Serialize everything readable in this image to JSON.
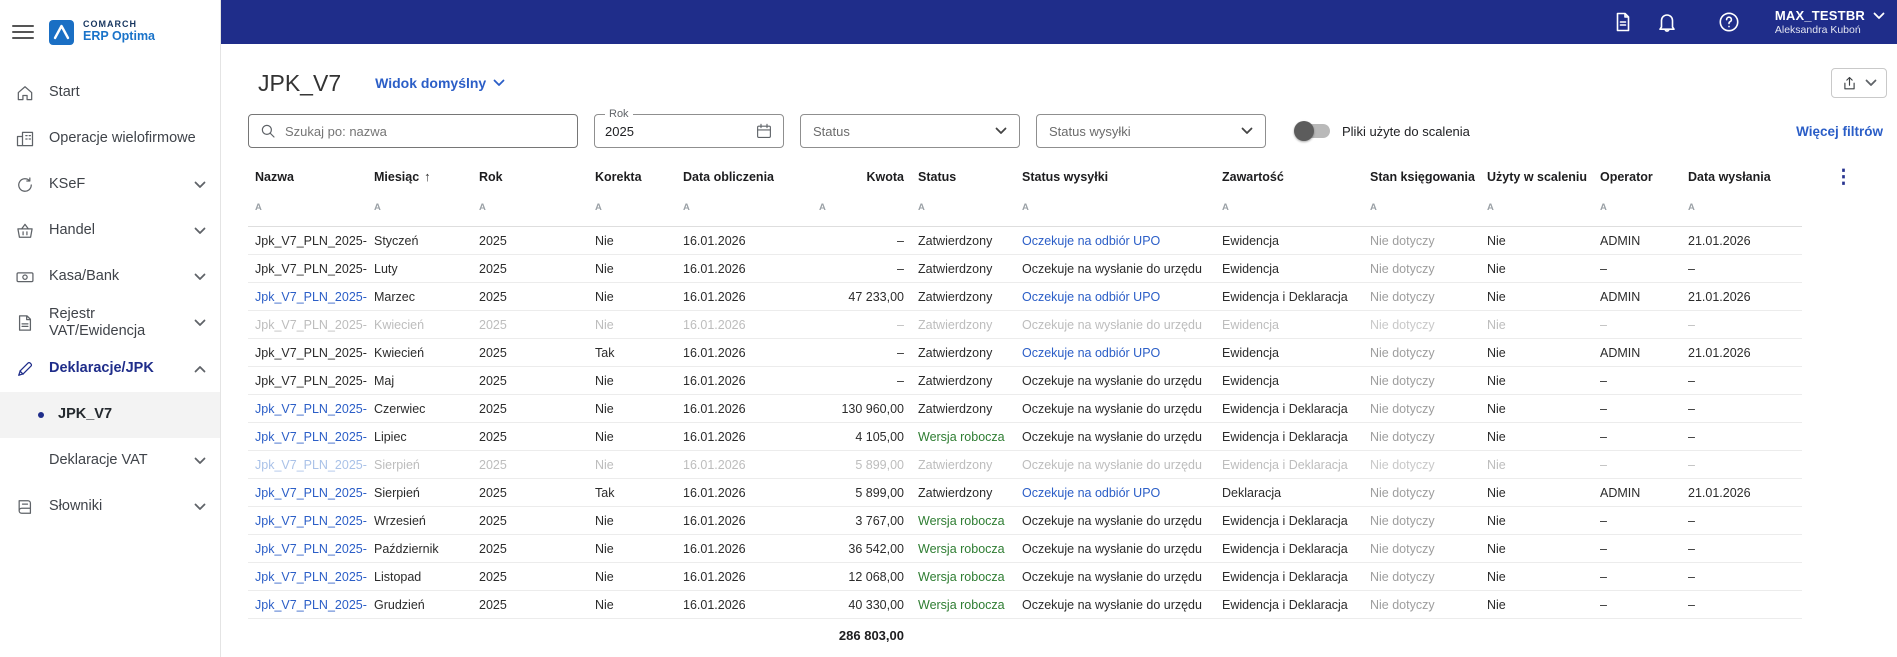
{
  "topbar": {
    "user_name": "MAX_TESTBR",
    "user_subtitle": "Aleksandra Kuboń",
    "icons": [
      "documents-icon",
      "notifications-icon",
      "help-icon",
      "chevron-down-icon"
    ]
  },
  "sidebar": {
    "logo": {
      "line1": "COMARCH",
      "line2": "ERP Optima"
    },
    "items": [
      {
        "label": "Start",
        "icon": "home-icon"
      },
      {
        "label": "Operacje wielofirmowe",
        "icon": "buildings-icon"
      },
      {
        "label": "KSeF",
        "icon": "sync-icon",
        "chevron": "down"
      },
      {
        "label": "Handel",
        "icon": "basket-icon",
        "chevron": "down"
      },
      {
        "label": "Kasa/Bank",
        "icon": "banknote-icon",
        "chevron": "down"
      },
      {
        "label": "Rejestr VAT/Ewidencja",
        "icon": "document-icon",
        "chevron": "down"
      },
      {
        "label": "Deklaracje/JPK",
        "icon": "pen-icon",
        "chevron": "up",
        "active": true
      },
      {
        "label": "JPK_V7",
        "selected": true
      },
      {
        "label": "Deklaracje VAT",
        "chevron": "down"
      },
      {
        "label": "Słowniki",
        "icon": "book-icon",
        "chevron": "down"
      }
    ]
  },
  "page": {
    "title": "JPK_V7",
    "view_selector": "Widok domyślny"
  },
  "filters": {
    "search_placeholder": "Szukaj po: nazwa",
    "rok_label": "Rok",
    "rok_value": "2025",
    "status_placeholder": "Status",
    "status_wysylki_placeholder": "Status wysyłki",
    "merge_toggle_label": "Pliki użyte do scalenia",
    "merge_toggle_state": "off",
    "more_filters_label": "Więcej filtrów"
  },
  "table": {
    "columns": [
      {
        "label": "Nazwa"
      },
      {
        "label": "Miesiąc",
        "sorted": true
      },
      {
        "label": "Rok"
      },
      {
        "label": "Korekta"
      },
      {
        "label": "Data obliczenia"
      },
      {
        "label": "Kwota",
        "right": true
      },
      {
        "label": "Status"
      },
      {
        "label": "Status wysyłki"
      },
      {
        "label": "Zawartość"
      },
      {
        "label": "Stan księgowania"
      },
      {
        "label": "Użyty w scaleniu"
      },
      {
        "label": "Operator"
      },
      {
        "label": "Data wysłania"
      }
    ],
    "rows": [
      {
        "nazwa": "Jpk_V7_PLN_2025-",
        "link": false,
        "muted": false,
        "miesiac": "Styczeń",
        "rok": "2025",
        "korekta": "Nie",
        "data_obliczenia": "16.01.2026",
        "kwota": "–",
        "status": "Zatwierdzony",
        "draft": false,
        "status_wysylki": "Oczekuje na odbiór UPO",
        "upo": true,
        "zawartosc": "Ewidencja",
        "stan_ksiegowania": "Nie dotyczy",
        "uzyty_w_scaleniu": "Nie",
        "operator": "ADMIN",
        "data_wyslania": "21.01.2026"
      },
      {
        "nazwa": "Jpk_V7_PLN_2025-",
        "link": false,
        "muted": false,
        "miesiac": "Luty",
        "rok": "2025",
        "korekta": "Nie",
        "data_obliczenia": "16.01.2026",
        "kwota": "–",
        "status": "Zatwierdzony",
        "draft": false,
        "status_wysylki": "Oczekuje na wysłanie do urzędu",
        "upo": false,
        "zawartosc": "Ewidencja",
        "stan_ksiegowania": "Nie dotyczy",
        "uzyty_w_scaleniu": "Nie",
        "operator": "–",
        "data_wyslania": "–"
      },
      {
        "nazwa": "Jpk_V7_PLN_2025-",
        "link": true,
        "muted": false,
        "miesiac": "Marzec",
        "rok": "2025",
        "korekta": "Nie",
        "data_obliczenia": "16.01.2026",
        "kwota": "47 233,00",
        "status": "Zatwierdzony",
        "draft": false,
        "status_wysylki": "Oczekuje na odbiór UPO",
        "upo": true,
        "zawartosc": "Ewidencja i Deklaracja",
        "stan_ksiegowania": "Nie dotyczy",
        "uzyty_w_scaleniu": "Nie",
        "operator": "ADMIN",
        "data_wyslania": "21.01.2026"
      },
      {
        "nazwa": "Jpk_V7_PLN_2025-",
        "link": false,
        "muted": true,
        "miesiac": "Kwiecień",
        "rok": "2025",
        "korekta": "Nie",
        "data_obliczenia": "16.01.2026",
        "kwota": "–",
        "status": "Zatwierdzony",
        "draft": false,
        "status_wysylki": "Oczekuje na wysłanie do urzędu",
        "upo": false,
        "zawartosc": "Ewidencja",
        "stan_ksiegowania": "Nie dotyczy",
        "uzyty_w_scaleniu": "Nie",
        "operator": "–",
        "data_wyslania": "–"
      },
      {
        "nazwa": "Jpk_V7_PLN_2025-",
        "link": false,
        "muted": false,
        "miesiac": "Kwiecień",
        "rok": "2025",
        "korekta": "Tak",
        "data_obliczenia": "16.01.2026",
        "kwota": "–",
        "status": "Zatwierdzony",
        "draft": false,
        "status_wysylki": "Oczekuje na odbiór UPO",
        "upo": true,
        "zawartosc": "Ewidencja",
        "stan_ksiegowania": "Nie dotyczy",
        "uzyty_w_scaleniu": "Nie",
        "operator": "ADMIN",
        "data_wyslania": "21.01.2026"
      },
      {
        "nazwa": "Jpk_V7_PLN_2025-",
        "link": false,
        "muted": false,
        "miesiac": "Maj",
        "rok": "2025",
        "korekta": "Nie",
        "data_obliczenia": "16.01.2026",
        "kwota": "–",
        "status": "Zatwierdzony",
        "draft": false,
        "status_wysylki": "Oczekuje na wysłanie do urzędu",
        "upo": false,
        "zawartosc": "Ewidencja",
        "stan_ksiegowania": "Nie dotyczy",
        "uzyty_w_scaleniu": "Nie",
        "operator": "–",
        "data_wyslania": "–"
      },
      {
        "nazwa": "Jpk_V7_PLN_2025-",
        "link": true,
        "muted": false,
        "miesiac": "Czerwiec",
        "rok": "2025",
        "korekta": "Nie",
        "data_obliczenia": "16.01.2026",
        "kwota": "130 960,00",
        "status": "Zatwierdzony",
        "draft": false,
        "status_wysylki": "Oczekuje na wysłanie do urzędu",
        "upo": false,
        "zawartosc": "Ewidencja i Deklaracja",
        "stan_ksiegowania": "Nie dotyczy",
        "uzyty_w_scaleniu": "Nie",
        "operator": "–",
        "data_wyslania": "–"
      },
      {
        "nazwa": "Jpk_V7_PLN_2025-",
        "link": true,
        "muted": false,
        "miesiac": "Lipiec",
        "rok": "2025",
        "korekta": "Nie",
        "data_obliczenia": "16.01.2026",
        "kwota": "4 105,00",
        "status": "Wersja robocza",
        "draft": true,
        "status_wysylki": "Oczekuje na wysłanie do urzędu",
        "upo": false,
        "zawartosc": "Ewidencja i Deklaracja",
        "stan_ksiegowania": "Nie dotyczy",
        "uzyty_w_scaleniu": "Nie",
        "operator": "–",
        "data_wyslania": "–"
      },
      {
        "nazwa": "Jpk_V7_PLN_2025-",
        "link": true,
        "muted": true,
        "miesiac": "Sierpień",
        "rok": "2025",
        "korekta": "Nie",
        "data_obliczenia": "16.01.2026",
        "kwota": "5 899,00",
        "status": "Zatwierdzony",
        "draft": false,
        "status_wysylki": "Oczekuje na wysłanie do urzędu",
        "upo": false,
        "zawartosc": "Ewidencja i Deklaracja",
        "stan_ksiegowania": "Nie dotyczy",
        "uzyty_w_scaleniu": "Nie",
        "operator": "–",
        "data_wyslania": "–"
      },
      {
        "nazwa": "Jpk_V7_PLN_2025-",
        "link": true,
        "muted": false,
        "miesiac": "Sierpień",
        "rok": "2025",
        "korekta": "Tak",
        "data_obliczenia": "16.01.2026",
        "kwota": "5 899,00",
        "status": "Zatwierdzony",
        "draft": false,
        "status_wysylki": "Oczekuje na odbiór UPO",
        "upo": true,
        "zawartosc": "Deklaracja",
        "stan_ksiegowania": "Nie dotyczy",
        "uzyty_w_scaleniu": "Nie",
        "operator": "ADMIN",
        "data_wyslania": "21.01.2026"
      },
      {
        "nazwa": "Jpk_V7_PLN_2025-",
        "link": true,
        "muted": false,
        "miesiac": "Wrzesień",
        "rok": "2025",
        "korekta": "Nie",
        "data_obliczenia": "16.01.2026",
        "kwota": "3 767,00",
        "status": "Wersja robocza",
        "draft": true,
        "status_wysylki": "Oczekuje na wysłanie do urzędu",
        "upo": false,
        "zawartosc": "Ewidencja i Deklaracja",
        "stan_ksiegowania": "Nie dotyczy",
        "uzyty_w_scaleniu": "Nie",
        "operator": "–",
        "data_wyslania": "–"
      },
      {
        "nazwa": "Jpk_V7_PLN_2025-",
        "link": true,
        "muted": false,
        "miesiac": "Październik",
        "rok": "2025",
        "korekta": "Nie",
        "data_obliczenia": "16.01.2026",
        "kwota": "36 542,00",
        "status": "Wersja robocza",
        "draft": true,
        "status_wysylki": "Oczekuje na wysłanie do urzędu",
        "upo": false,
        "zawartosc": "Ewidencja i Deklaracja",
        "stan_ksiegowania": "Nie dotyczy",
        "uzyty_w_scaleniu": "Nie",
        "operator": "–",
        "data_wyslania": "–"
      },
      {
        "nazwa": "Jpk_V7_PLN_2025-",
        "link": true,
        "muted": false,
        "miesiac": "Listopad",
        "rok": "2025",
        "korekta": "Nie",
        "data_obliczenia": "16.01.2026",
        "kwota": "12 068,00",
        "status": "Wersja robocza",
        "draft": true,
        "status_wysylki": "Oczekuje na wysłanie do urzędu",
        "upo": false,
        "zawartosc": "Ewidencja i Deklaracja",
        "stan_ksiegowania": "Nie dotyczy",
        "uzyty_w_scaleniu": "Nie",
        "operator": "–",
        "data_wyslania": "–"
      },
      {
        "nazwa": "Jpk_V7_PLN_2025-",
        "link": true,
        "muted": false,
        "miesiac": "Grudzień",
        "rok": "2025",
        "korekta": "Nie",
        "data_obliczenia": "16.01.2026",
        "kwota": "40 330,00",
        "status": "Wersja robocza",
        "draft": true,
        "status_wysylki": "Oczekuje na wysłanie do urzędu",
        "upo": false,
        "zawartosc": "Ewidencja i Deklaracja",
        "stan_ksiegowania": "Nie dotyczy",
        "uzyty_w_scaleniu": "Nie",
        "operator": "–",
        "data_wyslania": "–"
      }
    ],
    "total_kwota": "286 803,00"
  }
}
